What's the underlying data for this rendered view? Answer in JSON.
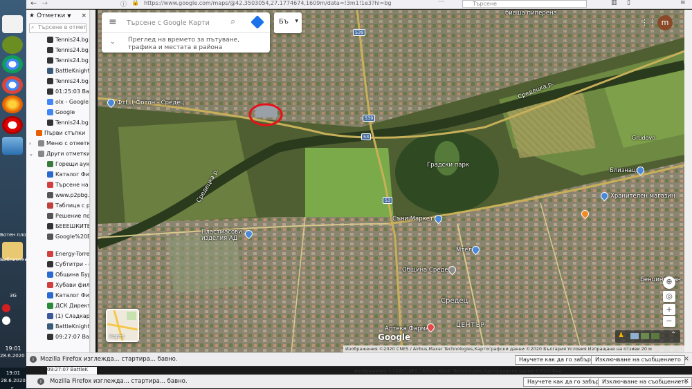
{
  "browser": {
    "url": "https://www.google.com/maps/@42.3503054,27.1774674,1609m/data=!3m1!1e3?hl=bg",
    "search_placeholder": "Търсене"
  },
  "desktop": {
    "labels": [
      "Ботен плот",
      "Библиотеки",
      "3G"
    ],
    "clock_time": "19:01",
    "clock_date": "28.6.2020 г."
  },
  "sidebar": {
    "title": "Отметки",
    "search_placeholder": "Търсене в отметките",
    "items": [
      {
        "label": "Tennis24.bg. Т",
        "color": "#333333"
      },
      {
        "label": "Tennis24.bg. В",
        "color": "#333333"
      },
      {
        "label": "Tennis24.bg. В",
        "color": "#333333"
      },
      {
        "label": "BattleKnight",
        "color": "#3a5a7a"
      },
      {
        "label": "Tennis24.bg. В",
        "color": "#333333"
      },
      {
        "label": "01:25:03 Battle",
        "color": "#333333"
      },
      {
        "label": "olx - Google Т",
        "color": "#4285f4"
      },
      {
        "label": "Google",
        "color": "#4285f4"
      },
      {
        "label": "Tennis24.bg. В",
        "color": "#333333"
      },
      {
        "label": "Първи стъпки",
        "color": "#e66000"
      },
      {
        "label": "Меню с отметки",
        "color": "#888888"
      },
      {
        "label": "Други отметки",
        "color": "#888888"
      },
      {
        "label": "Горещи аукцион",
        "color": "#3a7a3a"
      },
      {
        "label": "Каталог Филми",
        "color": "#2a6ad0"
      },
      {
        "label": "Търсене на сток",
        "color": "#d04040"
      },
      {
        "label": "www.p2pbg.com",
        "color": "#555555"
      },
      {
        "label": "Таблица с разм",
        "color": "#c04040"
      },
      {
        "label": "Решение по Гра",
        "color": "#555555"
      },
      {
        "label": "БЕЕЕШКИТЕ РЕШ",
        "color": "#333333"
      },
      {
        "label": "Google%20Earth.",
        "color": "#555555"
      },
      {
        "label": "Energy-Torrent",
        "color": "#d04040"
      },
      {
        "label": "Субтитри - свал",
        "color": "#333333"
      },
      {
        "label": "Община Бургас",
        "color": "#2a6ad0"
      },
      {
        "label": "Хубави филми |",
        "color": "#d04040"
      },
      {
        "label": "Каталог Филми",
        "color": "#2a6ad0"
      },
      {
        "label": "ДСК Директ",
        "color": "#2a8a3a"
      },
      {
        "label": "(1) Сладкарски",
        "color": "#3b5998"
      },
      {
        "label": "BattleKnight",
        "color": "#3a5a7a"
      },
      {
        "label": "09:27:07 BattleK",
        "color": "#333333"
      }
    ]
  },
  "map": {
    "search_placeholder": "Търсене с Google Карти",
    "traffic_hint": "Преглед на времето за пътуване, трафика и местата в района",
    "lang": "Бъ",
    "layers_label": "Карта",
    "google_logo": "Google",
    "attribution": "Изображения ©2020 CNES / Airbus,Maxar Technologies,Картографски данни ©2020   България   Условия   Изпращане на отзиви   20 м",
    "labels": [
      {
        "text": "ФтЕЦ Фотон - Средец",
        "name": "label-ftec-foton"
      },
      {
        "text": "Градски парк",
        "name": "label-city-park"
      },
      {
        "text": "Средецка р.",
        "name": "label-river-top"
      },
      {
        "text": "Средецка р.",
        "name": "label-river-left"
      },
      {
        "text": "Grudovo",
        "name": "label-grudovo"
      },
      {
        "text": "Близнаци",
        "name": "label-bliznatsi"
      },
      {
        "text": "Хранителен магазин",
        "name": "label-grocery"
      },
      {
        "text": "Съни Маркет",
        "name": "label-sunny-market"
      },
      {
        "text": "Пластмасови изделия АД",
        "name": "label-plastics"
      },
      {
        "text": "Мтел",
        "name": "label-mtel"
      },
      {
        "text": "Община Средец",
        "name": "label-municipality"
      },
      {
        "text": "Средец",
        "name": "label-sredets"
      },
      {
        "text": "Аптека Фарма",
        "name": "label-pharmacy"
      },
      {
        "text": "ЦЕНТЪР",
        "name": "label-center"
      },
      {
        "text": "Бенциностан",
        "name": "label-fuel"
      },
      {
        "text": "бивша пиперена",
        "name": "label-pepper-factory"
      },
      {
        "text": "539",
        "name": "road-539-top"
      },
      {
        "text": "539",
        "name": "road-539-mid"
      },
      {
        "text": "53",
        "name": "road-53-a"
      },
      {
        "text": "53",
        "name": "road-53-b"
      }
    ]
  },
  "notification": {
    "message": "Mozilla Firefox изглежда... стартира... бавно.",
    "learn_label": "Научете как да го забързате",
    "disable_label": "Изключване на съобщението",
    "close_symbol": "×"
  },
  "colors": {
    "highlight_circle": "#e8101a",
    "road": "#c8b05a",
    "pin_blue": "#4a88d8",
    "pin_red": "#e34a4a",
    "pin_orange": "#f08a24"
  }
}
